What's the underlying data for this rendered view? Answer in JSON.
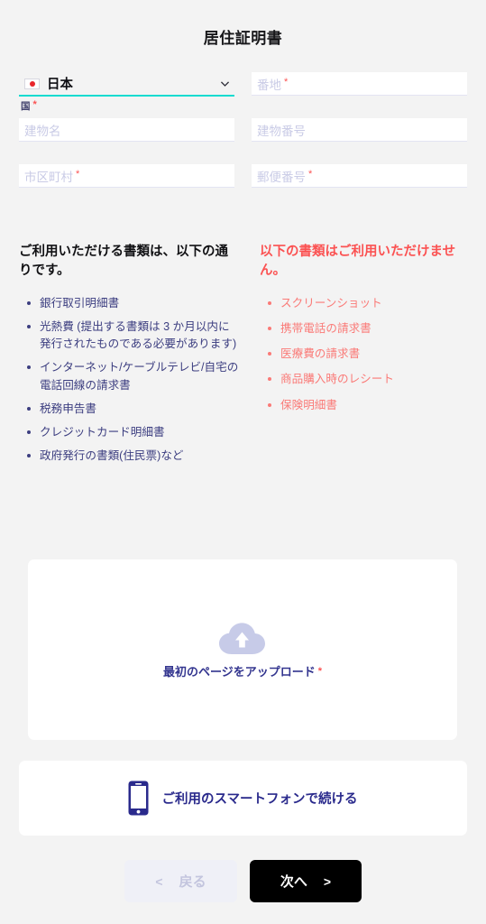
{
  "page": {
    "title": "居住証明書"
  },
  "form": {
    "country": {
      "label": "国",
      "required_mark": "*",
      "value": "日本",
      "flag": "jp-flag-icon",
      "chevron": "chevron-down-icon"
    },
    "fields": [
      {
        "name": "street-address",
        "placeholder": "番地",
        "required_mark": "*",
        "value": ""
      },
      {
        "name": "building-name",
        "placeholder": "建物名",
        "required_mark": "",
        "value": ""
      },
      {
        "name": "building-number",
        "placeholder": "建物番号",
        "required_mark": "",
        "value": ""
      },
      {
        "name": "city",
        "placeholder": "市区町村",
        "required_mark": "*",
        "value": ""
      },
      {
        "name": "postal-code",
        "placeholder": "郵便番号",
        "required_mark": "*",
        "value": ""
      }
    ]
  },
  "accepted": {
    "heading": "ご利用いただける書類は、以下の通りです。",
    "items": [
      "銀行取引明細書",
      "光熱費 (提出する書類は 3 か月以内に発行されたものである必要があります)",
      "インターネット/ケーブルテレビ/自宅の電話回線の請求書",
      "税務申告書",
      "クレジットカード明細書",
      "政府発行の書類(住民票)など"
    ]
  },
  "rejected": {
    "heading": "以下の書類はご利用いただけません。",
    "items": [
      "スクリーンショット",
      "携帯電話の請求書",
      "医療費の請求書",
      "商品購入時のレシート",
      "保険明細書"
    ]
  },
  "upload": {
    "icon": "cloud-upload-icon",
    "label": "最初のページをアップロード",
    "required_mark": "*"
  },
  "phone": {
    "icon": "smartphone-icon",
    "label": "ご利用のスマートフォンで続ける"
  },
  "nav": {
    "back_label": "戻る",
    "back_arrow": "<",
    "next_label": "次へ",
    "next_arrow": ">"
  },
  "colors": {
    "accent_underline": "#13dbd0",
    "required": "#fb5252",
    "accepted_text": "#3c3e80",
    "rejected_text": "#fa7a77",
    "next_button": "#000000",
    "page_background": "#f3f3f3"
  }
}
